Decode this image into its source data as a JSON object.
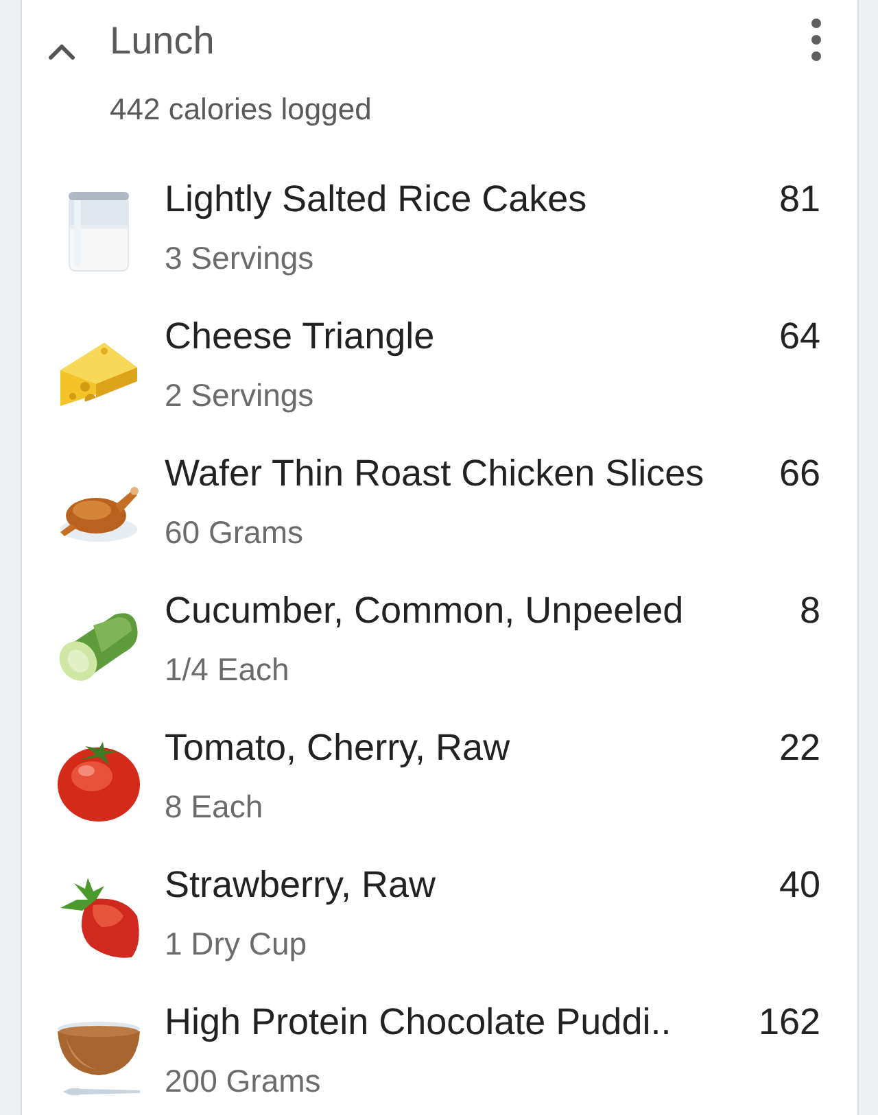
{
  "meal": {
    "title": "Lunch",
    "expanded": true,
    "summary": "442 calories logged"
  },
  "foods": [
    {
      "kind": "jar",
      "name": "Lightly Salted Rice Cakes",
      "amount": "3 Servings",
      "calories": "81"
    },
    {
      "kind": "cheese",
      "name": "Cheese Triangle",
      "amount": "2 Servings",
      "calories": "64"
    },
    {
      "kind": "chicken",
      "name": "Wafer Thin Roast Chicken Slices",
      "amount": "60 Grams",
      "calories": "66"
    },
    {
      "kind": "cucumber",
      "name": "Cucumber, Common, Unpeeled",
      "amount": "1/4 Each",
      "calories": "8"
    },
    {
      "kind": "tomato",
      "name": "Tomato, Cherry, Raw",
      "amount": "8 Each",
      "calories": "22"
    },
    {
      "kind": "strawberry",
      "name": "Strawberry, Raw",
      "amount": "1 Dry Cup",
      "calories": "40"
    },
    {
      "kind": "bowl",
      "name": "High Protein Chocolate Puddi..",
      "amount": "200 Grams",
      "calories": "162"
    }
  ]
}
